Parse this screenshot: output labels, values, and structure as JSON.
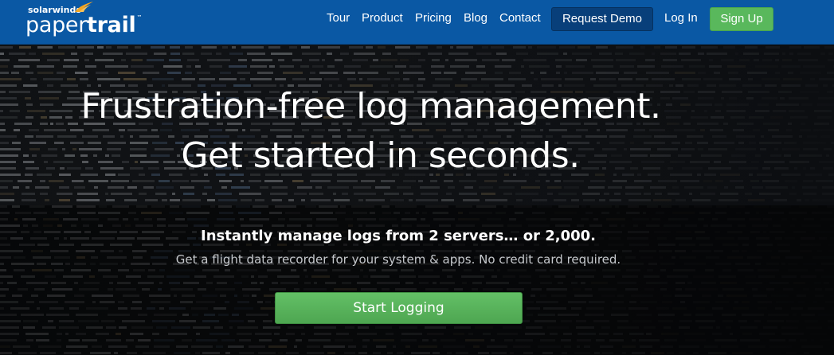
{
  "colors": {
    "nav_bg": "#0a58a4",
    "demo_button_bg": "#083f7a",
    "signup_button_bg": "#59b85c",
    "start_button_bg": "#59b85c",
    "logo_flame": "#f5a623"
  },
  "brand": {
    "parent": "solarwinds",
    "name_light": "paper",
    "name_bold": "trail",
    "trademark": "™"
  },
  "nav": {
    "links": [
      {
        "label": "Tour"
      },
      {
        "label": "Product"
      },
      {
        "label": "Pricing"
      },
      {
        "label": "Blog"
      },
      {
        "label": "Contact"
      }
    ],
    "request_demo": "Request Demo",
    "log_in": "Log In",
    "sign_up": "Sign Up"
  },
  "hero": {
    "headline_line1": "Frustration-free log management.",
    "headline_line2": "Get started in seconds.",
    "subheadline": "Instantly manage logs from 2 servers… or 2,000.",
    "subtext": "Get a flight data recorder for your system & apps. No credit card required.",
    "cta": "Start Logging",
    "background": "terminal-log-output-photo"
  }
}
